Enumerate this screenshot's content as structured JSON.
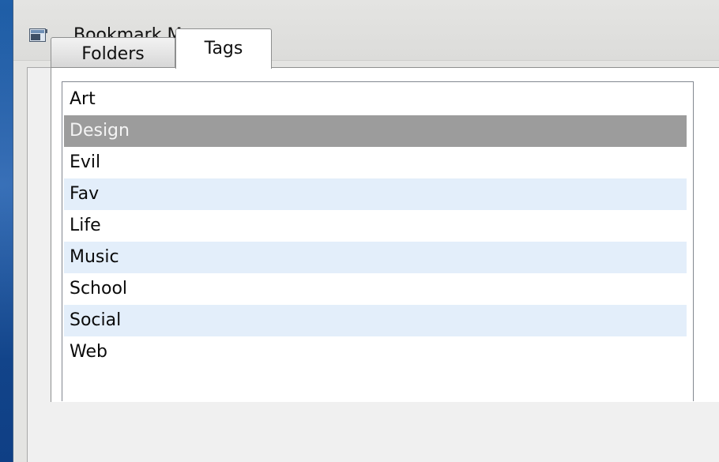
{
  "window": {
    "title": "Bookmark Manager",
    "icon": "app-window-icon"
  },
  "tabs": [
    {
      "label": "Folders",
      "active": false
    },
    {
      "label": "Tags",
      "active": true
    }
  ],
  "tags_list": {
    "items": [
      {
        "label": "Art",
        "state": "normal"
      },
      {
        "label": "Design",
        "state": "selected"
      },
      {
        "label": "Evil",
        "state": "normal"
      },
      {
        "label": "Fav",
        "state": "alternate"
      },
      {
        "label": "Life",
        "state": "normal"
      },
      {
        "label": "Music",
        "state": "alternate"
      },
      {
        "label": "School",
        "state": "normal"
      },
      {
        "label": "Social",
        "state": "alternate"
      },
      {
        "label": "Web",
        "state": "normal"
      }
    ]
  },
  "colors": {
    "selected_row": "#9c9c9c",
    "alternate_row": "#e3eefa",
    "window_chrome": "#e4e4e2"
  }
}
